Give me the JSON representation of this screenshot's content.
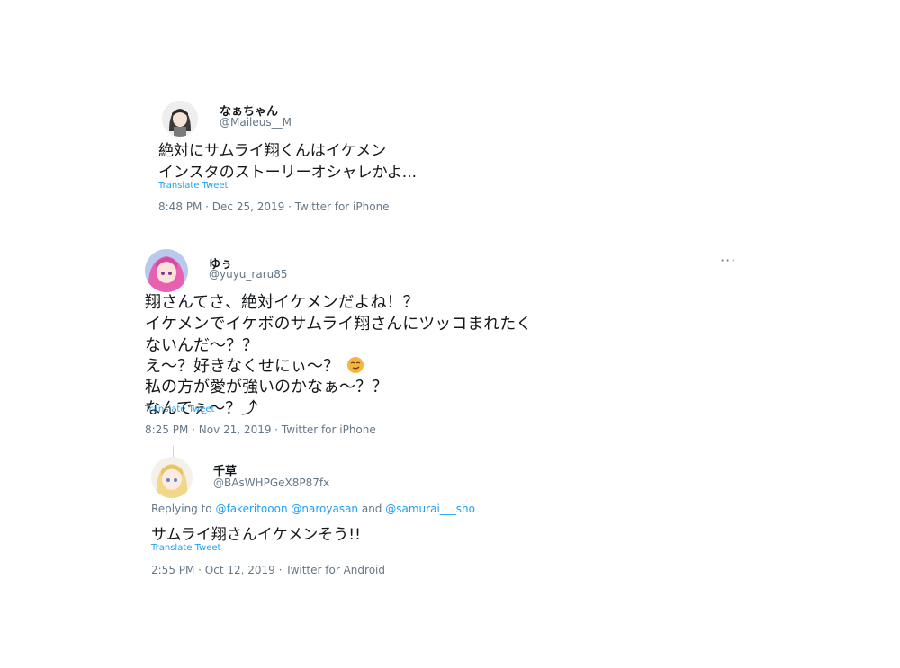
{
  "tweets": [
    {
      "name": "なぁちゃん",
      "handle": "@Maileus__M",
      "lines": [
        "絶対にサムライ翔くんはイケメン",
        "インスタのストーリーオシャレかよ..."
      ],
      "translate": "Translate Tweet",
      "time": "8:48 PM · Dec 25, 2019 · Twitter for iPhone"
    },
    {
      "name": "ゆぅ",
      "handle": "@yuyu_raru85",
      "more": "···",
      "lines": [
        "翔さんてさ、絶対イケメンだよね！？",
        "イケメンでイケボのサムライ翔さんにツッコまれたく",
        "ないんだ〜？？",
        "え〜？好きなくせにぃ〜？",
        "私の方が愛が強いのかなぁ〜？？",
        "なんでぇ〜？⤴"
      ],
      "translate": "Translate Tweet",
      "time": "8:25 PM · Nov 21, 2019 · Twitter for iPhone"
    },
    {
      "name": "千草",
      "handle": "@BAsWHPGeX8P87fx",
      "replying_prefix": "Replying to ",
      "replying_to": [
        "@fakeritooon",
        "@naroyasan",
        "@samurai___sho"
      ],
      "replying_and": " and ",
      "lines": [
        "サムライ翔さんイケメンそう!!"
      ],
      "translate": "Translate Tweet",
      "time": "2:55 PM · Oct 12, 2019 · Twitter for Android"
    }
  ],
  "colors": {
    "link": "#1da1f2",
    "muted": "#657786",
    "text": "#14171a",
    "emoji": "#f4b63f"
  },
  "icons": [
    "avatar-image",
    "smirk-emoji-icon",
    "more-icon"
  ]
}
